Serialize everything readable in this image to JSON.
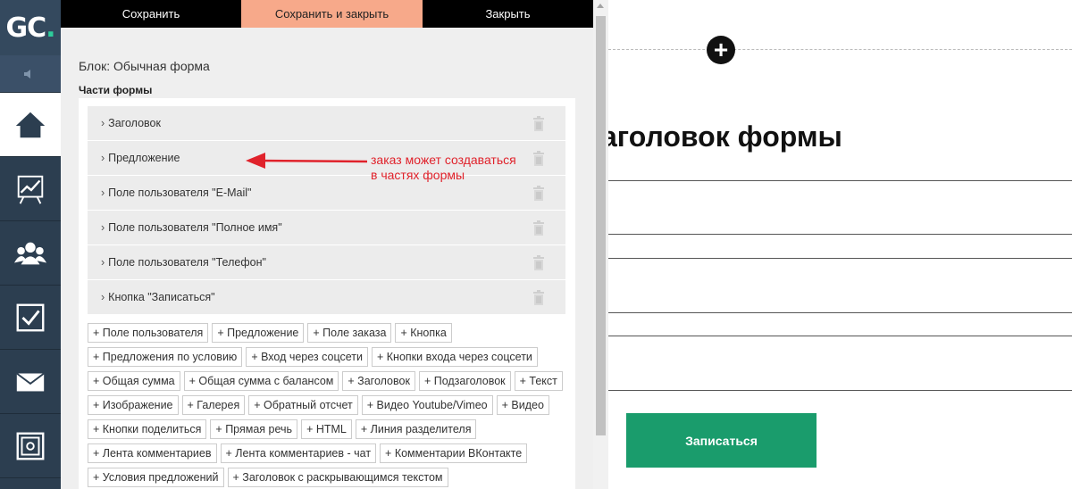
{
  "logo": {
    "g": "G",
    "c": "C",
    "dot": "."
  },
  "sidebar": {
    "items": [
      {
        "icon": "home-icon"
      },
      {
        "icon": "chart-board-icon"
      },
      {
        "icon": "users-icon"
      },
      {
        "icon": "checkbox-icon"
      },
      {
        "icon": "mail-icon"
      },
      {
        "icon": "safe-icon"
      }
    ]
  },
  "toolbar": {
    "save_label": "Сохранить",
    "save_close_label": "Сохранить и закрыть",
    "close_label": "Закрыть"
  },
  "editor": {
    "block_title": "Блок: Обычная форма",
    "parts_title": "Части формы",
    "parts": [
      {
        "label": "Заголовок"
      },
      {
        "label": "Предложение"
      },
      {
        "label": "Поле пользователя \"E-Mail\""
      },
      {
        "label": "Поле пользователя \"Полное имя\""
      },
      {
        "label": "Поле пользователя \"Телефон\""
      },
      {
        "label": "Кнопка \"Записаться\""
      }
    ],
    "add_buttons": [
      [
        "+ Поле пользователя",
        "+ Предложение",
        "+ Поле заказа",
        "+ Кнопка"
      ],
      [
        "+ Предложения по условию",
        "+ Вход через соцсети",
        "+ Кнопки входа через соцсети"
      ],
      [
        "+ Общая сумма",
        "+ Общая сумма с балансом",
        "+ Заголовок",
        "+ Подзаголовок",
        "+ Текст"
      ],
      [
        "+ Изображение",
        "+ Галерея",
        "+ Обратный отсчет",
        "+ Видео Youtube/Vimeo",
        "+ Видео"
      ],
      [
        "+ Кнопки поделиться",
        "+ Прямая речь",
        "+ HTML",
        "+ Линия разделителя"
      ],
      [
        "+ Лента комментариев",
        "+ Лента комментариев - чат",
        "+ Комментарии ВКонтакте"
      ],
      [
        "+ Условия предложений",
        "+ Заголовок с раскрывающимся текстом"
      ]
    ]
  },
  "annotation": {
    "line1": "заказ может создаваться",
    "line2": "в частях формы",
    "color": "#e0222b"
  },
  "preview": {
    "heading": "аголовок формы",
    "submit_label": "Записаться",
    "submit_color": "#1a9c6c"
  }
}
